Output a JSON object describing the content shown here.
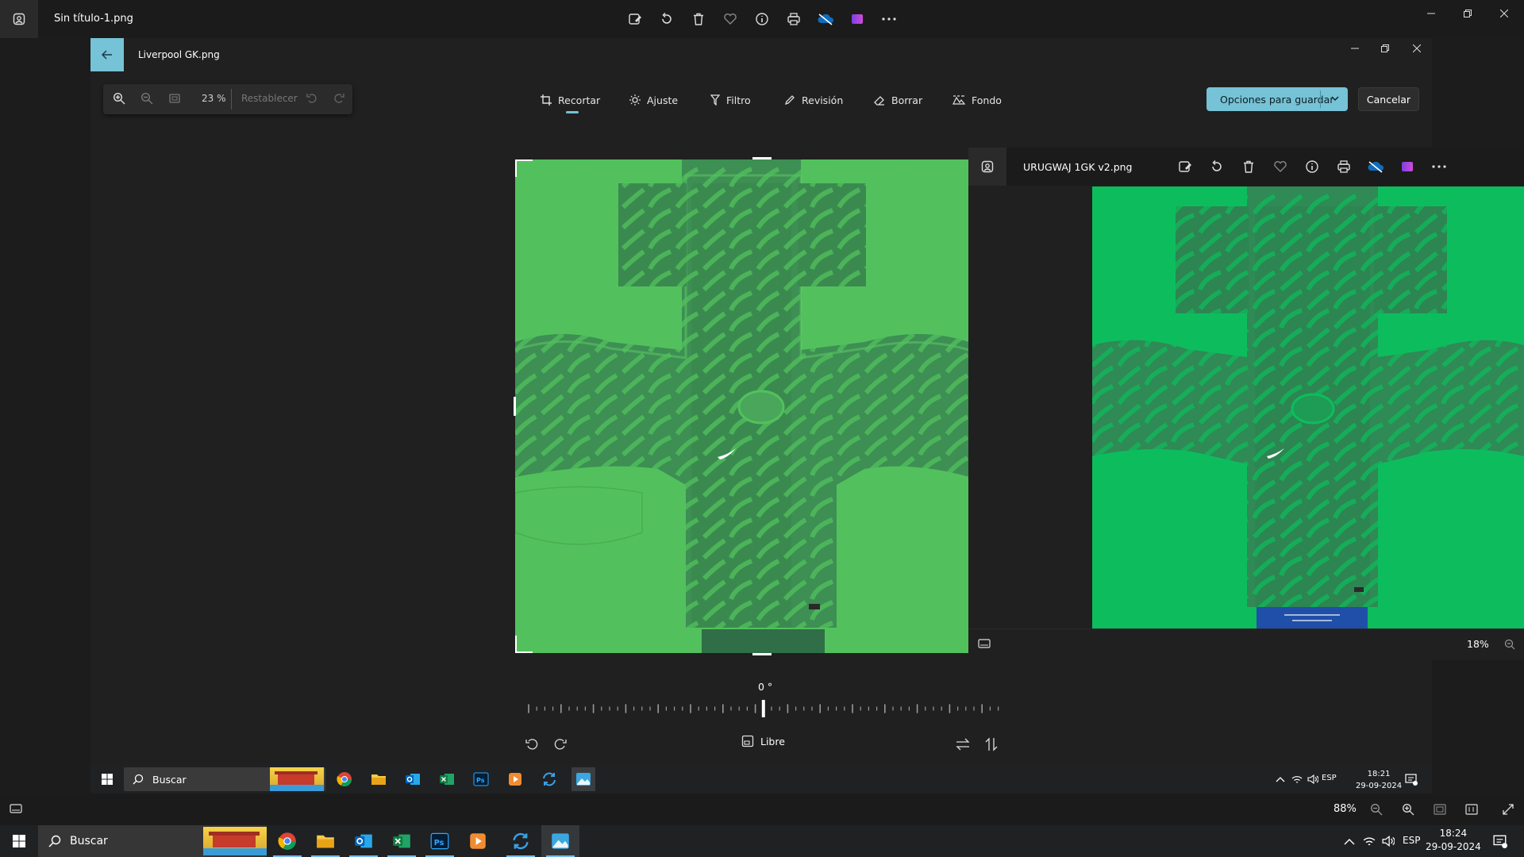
{
  "outer_window": {
    "file_name": "Sin título-1.png",
    "zoom": "88%"
  },
  "editor": {
    "file_name": "Liverpool GK.png",
    "zoom_percent": "23 %",
    "reset_label": "Restablecer",
    "tabs": [
      {
        "label": "Recortar"
      },
      {
        "label": "Ajuste"
      },
      {
        "label": "Filtro"
      },
      {
        "label": "Revisión"
      },
      {
        "label": "Borrar"
      },
      {
        "label": "Fondo"
      }
    ],
    "save_label": "Opciones para guardar",
    "cancel_label": "Cancelar",
    "angle": "0 °",
    "aspect_label": "Libre"
  },
  "viewer": {
    "file_name": "URUGWAJ 1GK v2.png",
    "zoom": "18%"
  },
  "inner_taskbar": {
    "search_placeholder": "Buscar",
    "lang": "ESP",
    "time": "18:21",
    "date": "29-09-2024",
    "notif_count": "1"
  },
  "taskbar": {
    "search_placeholder": "Buscar",
    "lang": "ESP",
    "time": "18:24",
    "date": "29-09-2024",
    "notif_count": "1"
  },
  "colors": {
    "accent": "#76c2d6",
    "kit_green": "#52c15d",
    "kit_green_2": "#0dbd5d",
    "pattern_dark": "#2f6e47"
  }
}
